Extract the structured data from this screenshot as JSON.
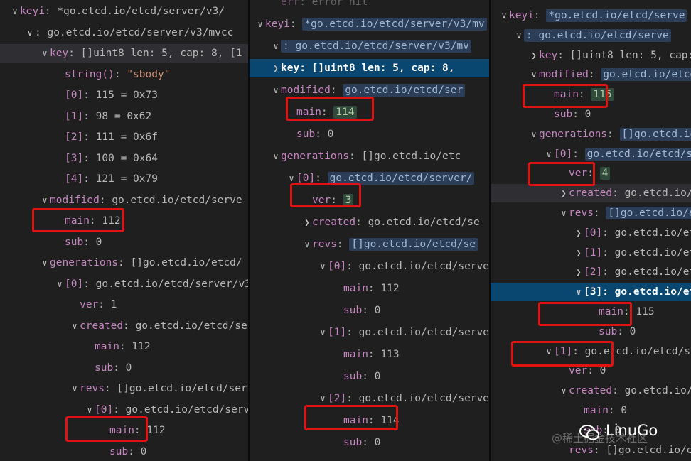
{
  "panels": [
    {
      "lines": [
        {
          "ind": 0,
          "chev": "down",
          "key": "keyi",
          "val": "*go.etcd.io/etcd/server/v3/",
          "pill": false
        },
        {
          "ind": 1,
          "chev": "down",
          "key": "",
          "val": ": go.etcd.io/etcd/server/v3/mvcc",
          "pill": false
        },
        {
          "ind": 2,
          "chev": "down",
          "key": "key",
          "val": "[]uint8 len: 5, cap: 8, [1",
          "hl": true
        },
        {
          "ind": 3,
          "key": "string()",
          "val": "\"sbody\"",
          "str": true
        },
        {
          "ind": 3,
          "key": "[0]",
          "val": "115 = 0x73"
        },
        {
          "ind": 3,
          "key": "[1]",
          "val": "98 = 0x62"
        },
        {
          "ind": 3,
          "key": "[2]",
          "val": "111 = 0x6f"
        },
        {
          "ind": 3,
          "key": "[3]",
          "val": "100 = 0x64"
        },
        {
          "ind": 3,
          "key": "[4]",
          "val": "121 = 0x79"
        },
        {
          "ind": 2,
          "chev": "down",
          "key": "modified",
          "val": "go.etcd.io/etcd/serve"
        },
        {
          "ind": 3,
          "key": "main",
          "val": "112"
        },
        {
          "ind": 3,
          "key": "sub",
          "val": "0"
        },
        {
          "ind": 2,
          "chev": "down",
          "key": "generations",
          "val": "[]go.etcd.io/etcd/"
        },
        {
          "ind": 3,
          "chev": "down",
          "key": "[0]",
          "val": "go.etcd.io/etcd/server/v3"
        },
        {
          "ind": 4,
          "key": "ver",
          "val": "1"
        },
        {
          "ind": 4,
          "chev": "down",
          "key": "created",
          "val": "go.etcd.io/etcd/serv"
        },
        {
          "ind": 5,
          "key": "main",
          "val": "112"
        },
        {
          "ind": 5,
          "key": "sub",
          "val": "0"
        },
        {
          "ind": 4,
          "chev": "down",
          "key": "revs",
          "val": "[]go.etcd.io/etcd/serve"
        },
        {
          "ind": 5,
          "chev": "down",
          "key": "[0]",
          "val": "go.etcd.io/etcd/server/"
        },
        {
          "ind": 6,
          "key": "main",
          "val": "112"
        },
        {
          "ind": 6,
          "key": "sub",
          "val": "0"
        }
      ]
    },
    {
      "lines": [
        {
          "ind": 1,
          "key": "err",
          "val": "error nil",
          "faded": true
        },
        {
          "ind": 0,
          "chev": "down",
          "key": "keyi",
          "val": "*go.etcd.io/etcd/server/v3/mv",
          "pill": true
        },
        {
          "ind": 1,
          "chev": "down",
          "key": "",
          "val": ": go.etcd.io/etcd/server/v3/mv",
          "pill": true
        },
        {
          "ind": 1,
          "chev": "right",
          "key": "key",
          "val": "[]uint8 len: 5, cap: 8,",
          "sel": true
        },
        {
          "ind": 1,
          "chev": "down",
          "key": "modified",
          "val": "go.etcd.io/etcd/ser",
          "pill": true
        },
        {
          "ind": 2,
          "key": "main",
          "val": "114",
          "num": true
        },
        {
          "ind": 2,
          "key": "sub",
          "val": "0"
        },
        {
          "ind": 1,
          "chev": "down",
          "key": "generations",
          "val": "[]go.etcd.io/etc"
        },
        {
          "ind": 2,
          "chev": "down",
          "key": "[0]",
          "val": "go.etcd.io/etcd/server/",
          "pill": true
        },
        {
          "ind": 3,
          "key": "ver",
          "val": "3",
          "num": true
        },
        {
          "ind": 3,
          "chev": "right",
          "key": "created",
          "val": "go.etcd.io/etcd/se"
        },
        {
          "ind": 3,
          "chev": "down",
          "key": "revs",
          "val": "[]go.etcd.io/etcd/se",
          "pill": true
        },
        {
          "ind": 4,
          "chev": "down",
          "key": "[0]",
          "val": "go.etcd.io/etcd/serve"
        },
        {
          "ind": 5,
          "key": "main",
          "val": "112"
        },
        {
          "ind": 5,
          "key": "sub",
          "val": "0"
        },
        {
          "ind": 4,
          "chev": "down",
          "key": "[1]",
          "val": "go.etcd.io/etcd/serve"
        },
        {
          "ind": 5,
          "key": "main",
          "val": "113"
        },
        {
          "ind": 5,
          "key": "sub",
          "val": "0"
        },
        {
          "ind": 4,
          "chev": "down",
          "key": "[2]",
          "val": "go.etcd.io/etcd/serve"
        },
        {
          "ind": 5,
          "key": "main",
          "val": "114"
        },
        {
          "ind": 5,
          "key": "sub",
          "val": "0"
        }
      ]
    },
    {
      "lines": [
        {
          "ind": 0,
          "chev": "down",
          "key": "keyi",
          "val": "*go.etcd.io/etcd/serve",
          "pill": true
        },
        {
          "ind": 1,
          "chev": "down",
          "key": "",
          "val": ": go.etcd.io/etcd/serve",
          "pill": true
        },
        {
          "ind": 2,
          "chev": "right",
          "key": "key",
          "val": "[]uint8 len: 5, cap:"
        },
        {
          "ind": 2,
          "chev": "down",
          "key": "modified",
          "val": "go.etcd.io/etcd/s",
          "pill": true
        },
        {
          "ind": 3,
          "key": "main",
          "val": "115",
          "num": true
        },
        {
          "ind": 3,
          "key": "sub",
          "val": "0"
        },
        {
          "ind": 2,
          "chev": "down",
          "key": "generations",
          "val": "[]go.etcd.io/e",
          "pill": true
        },
        {
          "ind": 3,
          "chev": "down",
          "key": "[0]",
          "val": "go.etcd.io/etcd/ser",
          "pill": true
        },
        {
          "ind": 4,
          "key": "ver",
          "val": "4",
          "num": true
        },
        {
          "ind": 4,
          "chev": "right",
          "key": "created",
          "val": "go.etcd.io/etc",
          "hl": true
        },
        {
          "ind": 4,
          "chev": "down",
          "key": "revs",
          "val": "[]go.etcd.io/etcd",
          "pill": true
        },
        {
          "ind": 5,
          "chev": "right",
          "key": "[0]",
          "val": "go.etcd.io/etcd/s"
        },
        {
          "ind": 5,
          "chev": "right",
          "key": "[1]",
          "val": "go.etcd.io/etcd/s"
        },
        {
          "ind": 5,
          "chev": "right",
          "key": "[2]",
          "val": "go.etcd.io/etcd/s"
        },
        {
          "ind": 5,
          "chev": "down",
          "key": "[3]",
          "val": "go.etcd.io/etcd/s",
          "sel": true
        },
        {
          "ind": 6,
          "key": "main",
          "val": "115"
        },
        {
          "ind": 6,
          "key": "sub",
          "val": "0"
        },
        {
          "ind": 3,
          "chev": "down",
          "key": "[1]",
          "val": "go.etcd.io/etcd/ser"
        },
        {
          "ind": 4,
          "key": "ver",
          "val": "0"
        },
        {
          "ind": 4,
          "chev": "down",
          "key": "created",
          "val": "go.etcd.io/etc"
        },
        {
          "ind": 5,
          "key": "main",
          "val": "0"
        },
        {
          "ind": 5,
          "key": "sub",
          "val": "0"
        },
        {
          "ind": 4,
          "key": "revs",
          "val": "[]go.etcd.io/etcd/se"
        }
      ]
    }
  ],
  "watermark": {
    "brand": "LinuGo",
    "community": "@稀土掘金技术社区"
  },
  "colors": {
    "highlight_box": "#e01212",
    "selection": "#094771"
  }
}
